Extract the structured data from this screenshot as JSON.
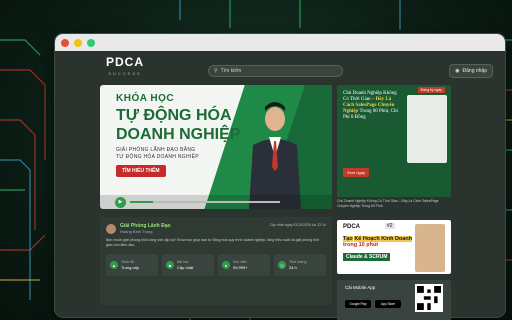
{
  "colors": {
    "accent": "#1f8a47",
    "cta": "#c62a2a",
    "highlight": "#f0d24a"
  },
  "window": {
    "dots": [
      "#e74c3c",
      "#f1c40f",
      "#2ecc71"
    ]
  },
  "header": {
    "logo": "PDCA",
    "logo_sub": "SUCCESS",
    "search_placeholder": "Tìm kiếm",
    "login_label": "Đăng nhập"
  },
  "hero": {
    "kicker": "KHÓA HỌC",
    "title_1": "TỰ ĐỘNG HÓA",
    "title_2": "DOANH NGHIỆP",
    "sub_1": "GIẢI PHÓNG LÃNH ĐẠO BẰNG",
    "sub_2": "TỰ ĐỘNG HÓA DOANH NGHIỆP",
    "cta": "TÌM HIỂU THÊM",
    "progress": 0.15
  },
  "course": {
    "title": "Giải Phóng Lãnh Đạo",
    "author": "Hoàng Bình Trọng",
    "date": "Cập nhật ngày 02/10/2025 lúc 22:14",
    "description": "Bạn muốn giải phóng khỏi công việc lặp lại? Khóa học giúp bạn tự động hóa quy trình doanh nghiệp, tăng hiệu suất và giải phóng thời gian cho lãnh đạo.",
    "stats": [
      {
        "icon": "chart-icon",
        "label": "Trình độ",
        "value": "Trung cấp"
      },
      {
        "icon": "book-icon",
        "label": "Bài học",
        "value": "Cập nhật"
      },
      {
        "icon": "user-icon",
        "label": "Học viên",
        "value": "99,999+"
      },
      {
        "icon": "clock-icon",
        "label": "Thời lượng",
        "value": "24 h"
      }
    ]
  },
  "side": {
    "card1_title_1": "Chủ Doanh Nghiệp Không Có Thời Gian –",
    "card1_title_hl": "Đây Là Cách SalesPage Chuyên Nghiệp",
    "card1_title_2": "Trong 60 Phút, Chi Phí 0 Đồng",
    "card1_tag": "Đăng ký ngay",
    "card1_btn": "Xem ngay",
    "card1_caption": "Chủ Doanh Nghiệp Không Có Thời Gian – Đây Là Cách SalesPage Chuyên Nghiệp Trong 60 Phút",
    "card2_logo": "PDCA",
    "card2_num": "#2",
    "card2_title_1": "Tạo",
    "card2_title_hl": "Kế Hoạch Kinh Doanh",
    "card2_title_2": "trong 10 phút",
    "card2_pill": "Claude & SCRUM",
    "app_title": "Cài Mobile App",
    "store_1": "Google Play",
    "store_2": "App Store"
  }
}
